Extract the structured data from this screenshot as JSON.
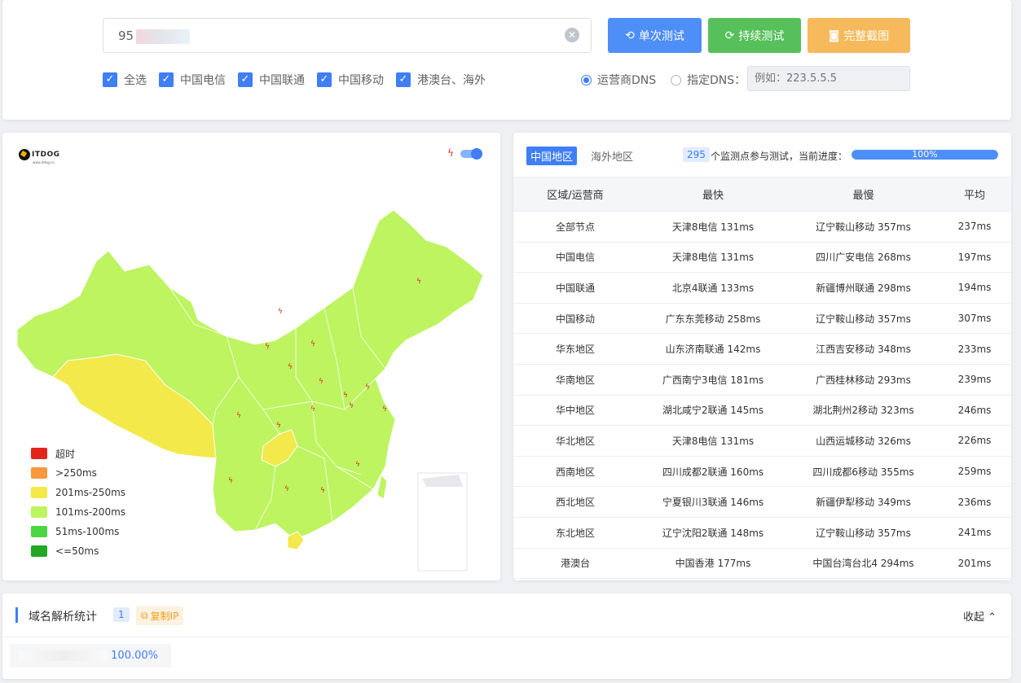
{
  "top": {
    "ip_value": "95          51",
    "clear_icon": "circle-x-icon",
    "buttons": {
      "single": "单次测试",
      "continuous": "持续测试",
      "screenshot": "完整截图"
    },
    "checkboxes": [
      "全选",
      "中国电信",
      "中国联通",
      "中国移动",
      "港澳台、海外"
    ],
    "radio_isp": "运营商DNS",
    "radio_custom": "指定DNS：",
    "dns_placeholder": "例如：223.5.5.5"
  },
  "map": {
    "logo_text": "ITDOG",
    "logo_sub": "www.itdog.cn",
    "legend": [
      {
        "label": "超时",
        "color": "#e3241b"
      },
      {
        "label": ">250ms",
        "color": "#f7993c"
      },
      {
        "label": "201ms-250ms",
        "color": "#f3e94a"
      },
      {
        "label": "101ms-200ms",
        "color": "#bdf460"
      },
      {
        "label": "51ms-100ms",
        "color": "#4ad743"
      },
      {
        "label": "<=50ms",
        "color": "#22a825"
      }
    ]
  },
  "results": {
    "tab_china": "中国地区",
    "tab_overseas": "海外地区",
    "node_count": "295",
    "progress_text": "个监测点参与测试，当前进度：",
    "progress_label": "100%",
    "progress_value": 1.0,
    "headers": [
      "区域/运营商",
      "最快",
      "最慢",
      "平均"
    ],
    "rows": [
      [
        "全部节点",
        "天津8电信 131ms",
        "辽宁鞍山移动 357ms",
        "237ms"
      ],
      [
        "中国电信",
        "天津8电信 131ms",
        "四川广安电信 268ms",
        "197ms"
      ],
      [
        "中国联通",
        "北京4联通 133ms",
        "新疆博州联通 298ms",
        "194ms"
      ],
      [
        "中国移动",
        "广东东莞移动 258ms",
        "辽宁鞍山移动 357ms",
        "307ms"
      ],
      [
        "华东地区",
        "山东济南联通 142ms",
        "江西吉安移动 348ms",
        "233ms"
      ],
      [
        "华南地区",
        "广西南宁3电信 181ms",
        "广西桂林移动 293ms",
        "239ms"
      ],
      [
        "华中地区",
        "湖北咸宁2联通 145ms",
        "湖北荆州2移动 323ms",
        "246ms"
      ],
      [
        "华北地区",
        "天津8电信 131ms",
        "山西运城移动 326ms",
        "226ms"
      ],
      [
        "西南地区",
        "四川成都2联通 160ms",
        "四川成都6移动 355ms",
        "259ms"
      ],
      [
        "西北地区",
        "宁夏银川3联通 146ms",
        "新疆伊犁移动 349ms",
        "236ms"
      ],
      [
        "东北地区",
        "辽宁沈阳2联通 148ms",
        "辽宁鞍山移动 357ms",
        "241ms"
      ],
      [
        "港澳台",
        "中国香港 177ms",
        "中国台湾台北4 294ms",
        "201ms"
      ]
    ]
  },
  "dns": {
    "title": "域名解析统计",
    "count": "1",
    "copy_label": "复制IP",
    "collapse_label": "收起",
    "item_percent": "100.00%"
  }
}
